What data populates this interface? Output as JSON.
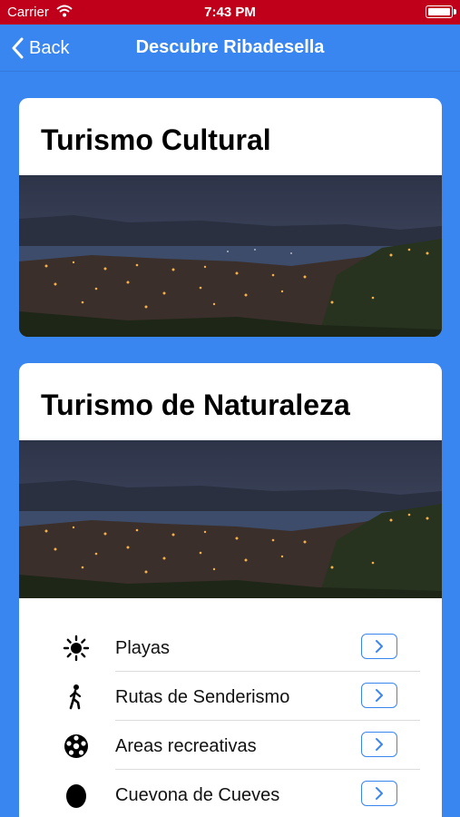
{
  "status_bar": {
    "carrier": "Carrier",
    "time": "7:43 PM"
  },
  "nav": {
    "back_label": "Back",
    "title": "Descubre Ribadesella"
  },
  "cards": {
    "cultural": {
      "title": "Turismo Cultural"
    },
    "naturaleza": {
      "title": "Turismo de Naturaleza",
      "items": [
        {
          "label": "Playas",
          "icon": "sun-icon"
        },
        {
          "label": "Rutas de Senderismo",
          "icon": "hiker-icon"
        },
        {
          "label": "Areas recreativas",
          "icon": "soccer-ball-icon"
        },
        {
          "label": "Cuevona de Cueves",
          "icon": "stone-icon"
        }
      ]
    }
  },
  "colors": {
    "background": "#3a86f1",
    "status_bar": "#c0001a",
    "accent": "#3a86f1"
  }
}
